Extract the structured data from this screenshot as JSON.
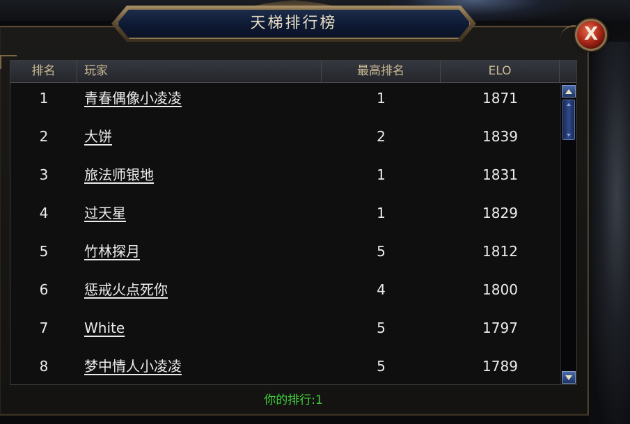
{
  "window": {
    "title": "天梯排行榜",
    "close_label": "X"
  },
  "table": {
    "headers": {
      "rank": "排名",
      "player": "玩家",
      "best_rank": "最高排名",
      "elo": "ELO"
    },
    "rows": [
      {
        "rank": "1",
        "player": "青春偶像小凌凌",
        "best_rank": "1",
        "elo": "1871"
      },
      {
        "rank": "2",
        "player": "大饼",
        "best_rank": "2",
        "elo": "1839"
      },
      {
        "rank": "3",
        "player": "旅法师银地",
        "best_rank": "1",
        "elo": "1831"
      },
      {
        "rank": "4",
        "player": "过天星",
        "best_rank": "1",
        "elo": "1829"
      },
      {
        "rank": "5",
        "player": "竹林探月",
        "best_rank": "5",
        "elo": "1812"
      },
      {
        "rank": "6",
        "player": "惩戒火点死你",
        "best_rank": "4",
        "elo": "1800"
      },
      {
        "rank": "7",
        "player": "White",
        "best_rank": "5",
        "elo": "1797"
      },
      {
        "rank": "8",
        "player": "梦中情人小凌凌",
        "best_rank": "5",
        "elo": "1789"
      }
    ]
  },
  "footer": {
    "my_rank": "你的排行:1"
  },
  "colors": {
    "title_text": "#e6dcc4",
    "header_text": "#cbb993",
    "row_text": "#ececec",
    "my_rank_text": "#3fcf3a",
    "close_button": "#b02a1a",
    "scrollbar": "#2d4a8a"
  },
  "icons": {
    "close": "close-icon",
    "scroll_up": "arrow-up-icon",
    "scroll_down": "arrow-down-icon"
  }
}
